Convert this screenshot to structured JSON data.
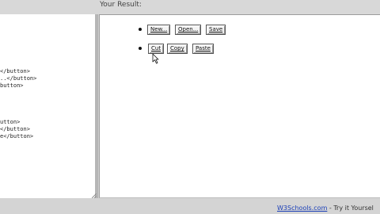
{
  "header": {
    "result_label": "Your Result:"
  },
  "code_lines": [
    "</button>",
    "..</button>",
    "button>",
    "utton>",
    "</button>",
    "e</button>"
  ],
  "result": {
    "row1": {
      "buttons": [
        "New...",
        "Open...",
        "Save"
      ]
    },
    "row2": {
      "buttons": [
        "Cut",
        "Copy",
        "Paste"
      ]
    }
  },
  "footer": {
    "link_text": "W3Schools.com",
    "tail_text": " - Try it Yoursel"
  },
  "colors": {
    "link": "#1b3fb8",
    "pane_bg": "#ffffff",
    "chrome_bg": "#d4d4d4"
  }
}
